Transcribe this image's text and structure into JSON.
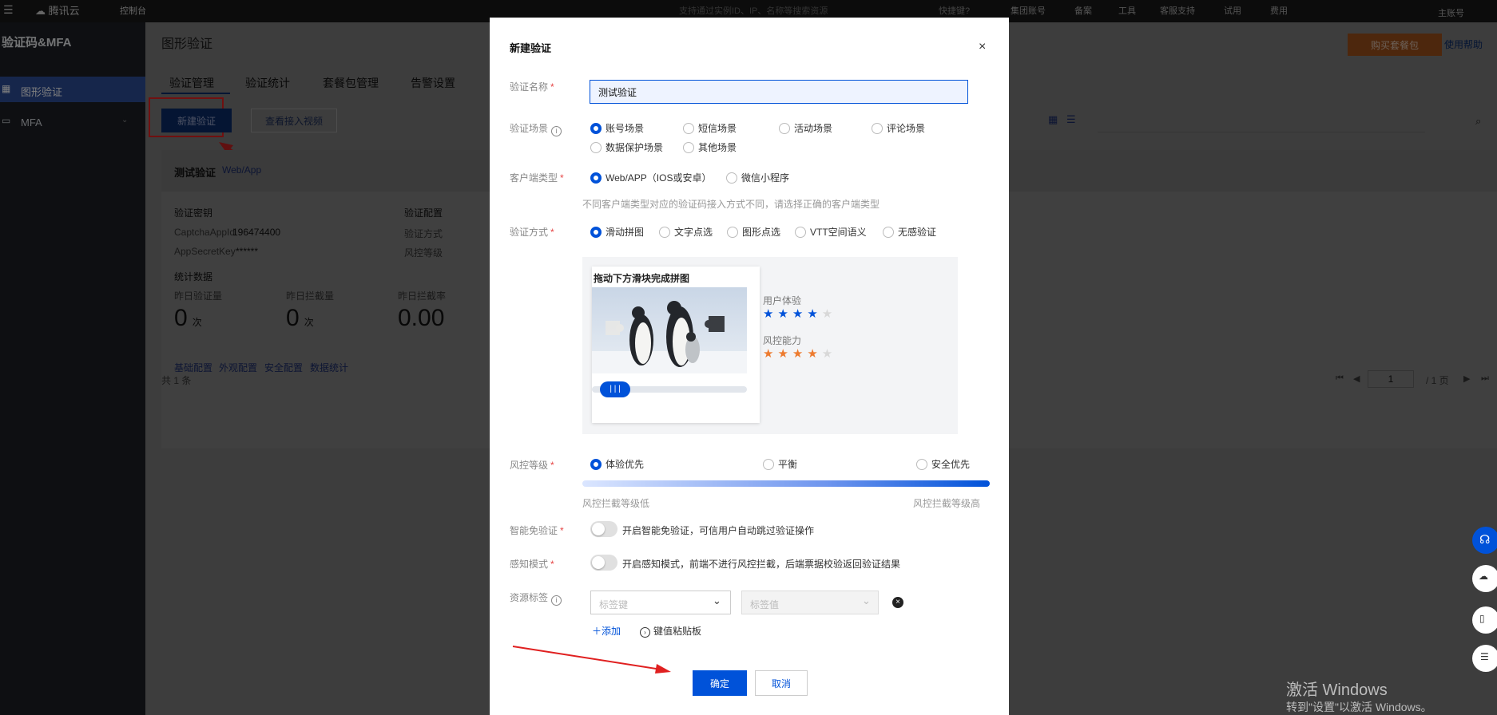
{
  "topbar": {
    "brand": "腾讯云",
    "console": "控制台",
    "search_placeholder": "支持通过实例ID、IP、名称等搜索资源",
    "shortcut": "快捷键?",
    "links": [
      "集团账号",
      "备案",
      "工具",
      "客服支持",
      "试用",
      "费用"
    ],
    "account": "主账号"
  },
  "sidebar": {
    "title": "验证码&MFA",
    "items": [
      {
        "label": "图形验证"
      },
      {
        "label": "MFA"
      }
    ]
  },
  "page": {
    "title": "图形验证",
    "tabs": [
      "验证管理",
      "验证统计",
      "套餐包管理",
      "告警设置"
    ],
    "buy_button": "购买套餐包",
    "help_link": "使用帮助",
    "new_button": "新建验证",
    "video_button": "查看接入视频"
  },
  "card": {
    "name": "测试验证",
    "tag": "Web/App",
    "secret_title": "验证密钥",
    "appid_label": "CaptchaAppId",
    "appid_value": "196474400",
    "secretkey_label": "AppSecretKey",
    "secretkey_value": "******",
    "config_title": "验证配置",
    "config_line1": "验证方式",
    "config_line2": "风控等级",
    "stats_title": "统计数据",
    "stat1_label": "昨日验证量",
    "stat1_value": "0",
    "stat1_unit": "次",
    "stat2_label": "昨日拦截量",
    "stat2_value": "0",
    "stat2_unit": "次",
    "stat3_label": "昨日拦截率",
    "stat3_value": "0.00",
    "links": [
      "基础配置",
      "外观配置",
      "安全配置",
      "数据统计"
    ]
  },
  "list": {
    "total": "共 1 条",
    "page_input": "1",
    "page_total": "/ 1 页"
  },
  "modal": {
    "title": "新建验证",
    "name_label": "验证名称",
    "name_value": "测试验证",
    "scene_label": "验证场景",
    "scenes": [
      "账号场景",
      "短信场景",
      "活动场景",
      "评论场景",
      "数据保护场景",
      "其他场景"
    ],
    "client_label": "客户端类型",
    "clients": [
      "Web/APP（IOS或安卓）",
      "微信小程序"
    ],
    "client_hint": "不同客户端类型对应的验证码接入方式不同，请选择正确的客户端类型",
    "method_label": "验证方式",
    "methods": [
      "滑动拼图",
      "文字点选",
      "图形点选",
      "VTT空间语义",
      "无感验证"
    ],
    "preview_title": "拖动下方滑块完成拼图",
    "ux_label": "用户体验",
    "ux_rating": 4,
    "risk_ability_label": "风控能力",
    "risk_rating": 4,
    "risk_label": "风控等级",
    "risk_levels": [
      "体验优先",
      "平衡",
      "安全优先"
    ],
    "risk_low": "风控拦截等级低",
    "risk_high": "风控拦截等级高",
    "smart_label": "智能免验证",
    "smart_text": "开启智能免验证，可信用户自动跳过验证操作",
    "sense_label": "感知模式",
    "sense_text": "开启感知模式，前端不进行风控拦截，后端票据校验返回验证结果",
    "tag_label": "资源标签",
    "tag_key_placeholder": "标签键",
    "tag_value_placeholder": "标签值",
    "add_link": "添加",
    "paste_link": "键值粘贴板",
    "confirm": "确定",
    "cancel": "取消"
  },
  "watermark": {
    "line1": "激活 Windows",
    "line2": "转到\"设置\"以激活 Windows。"
  },
  "colors": {
    "primary": "#0052d9",
    "danger": "#e54545",
    "orange": "#ed7b2f"
  }
}
